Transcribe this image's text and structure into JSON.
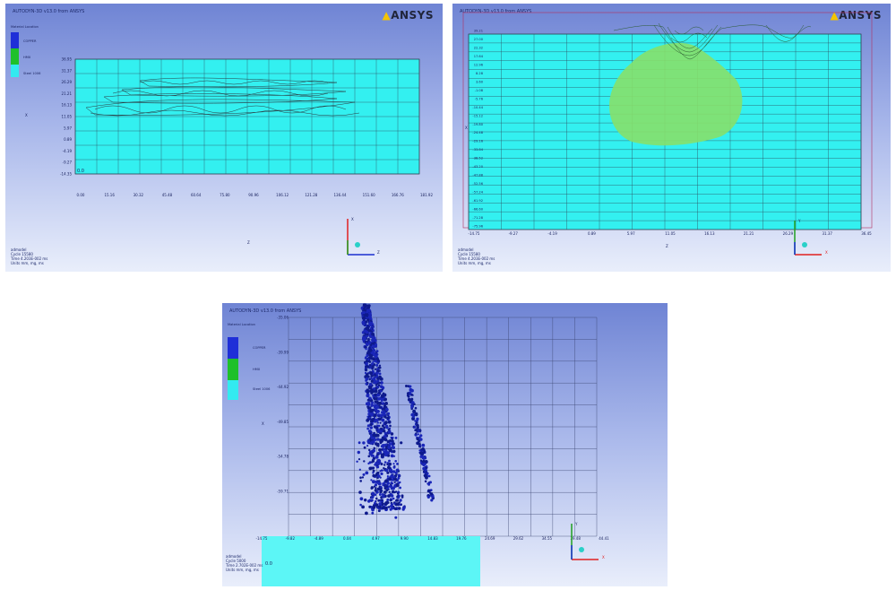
{
  "panels": [
    {
      "header": "AUTODYN-3D v13.0 from ANSYS",
      "logo": "ANSYS",
      "legend_title": "Material Location",
      "legend_items": [
        {
          "label": "COPPER",
          "color": "#1f2fd8"
        },
        {
          "label": "HMX",
          "color": "#1ec02a"
        },
        {
          "label": "Steel 1006",
          "color": "#33eaf0"
        }
      ],
      "y_ticks": [
        "36.95",
        "31.37",
        "26.29",
        "21.21",
        "16.13",
        "11.05",
        "5.97",
        "0.89",
        "-4.19",
        "-9.27",
        "-14.35"
      ],
      "x_ticks": [
        "0.00",
        "15.16",
        "30.32",
        "45.48",
        "60.64",
        "75.80",
        "90.96",
        "106.12",
        "121.28",
        "136.44",
        "151.60",
        "166.76",
        "181.92"
      ],
      "info": [
        "admodel",
        "Cycle 15580",
        "Time 4.203E-002 ms",
        "Units mm, mg, ms"
      ]
    },
    {
      "header": "AUTODYN-3D v13.0 from ANSYS",
      "logo": "ANSYS",
      "y_ticks": [
        "39.21",
        "27.00",
        "22.32",
        "17.64",
        "12.96",
        "8.28",
        "3.60",
        "-1.08",
        "-5.76",
        "-10.44",
        "-15.12",
        "-19.80",
        "-24.48",
        "-29.16",
        "-33.84",
        "-38.52",
        "-43.20",
        "-47.88",
        "-52.56",
        "-57.24",
        "-61.92",
        "-66.60",
        "-71.28",
        "-75.96"
      ],
      "x_ticks": [
        "-14.75",
        "-9.27",
        "-4.19",
        "0.89",
        "5.97",
        "11.05",
        "16.13",
        "21.21",
        "26.29",
        "31.37",
        "36.45"
      ],
      "info": [
        "admodel",
        "Cycle 15580",
        "Time 4.203E-002 ms",
        "Units mm, mg, ms"
      ]
    },
    {
      "header": "AUTODYN-3D v13.0 from ANSYS",
      "legend_title": "Material Location",
      "legend_items": [
        {
          "label": "COPPER",
          "color": "#1f2fd8"
        },
        {
          "label": "HMX",
          "color": "#1ec02a"
        },
        {
          "label": "Steel 1006",
          "color": "#33eaf0"
        }
      ],
      "y_ticks": [
        "-35.06",
        "-39.99",
        "-44.92",
        "-49.85",
        "-54.78",
        "-59.71"
      ],
      "x_ticks": [
        "-14.75",
        "-9.82",
        "-4.89",
        "0.04",
        "4.97",
        "9.90",
        "14.83",
        "19.76",
        "24.69",
        "29.62",
        "34.55",
        "39.48",
        "44.41"
      ],
      "info": [
        "admodel",
        "Cycle 5000",
        "Time 2.702E-002 ms",
        "Units mm, mg, ms"
      ]
    }
  ],
  "axes_labels": {
    "x": "X",
    "y": "Y",
    "z": "Z"
  }
}
